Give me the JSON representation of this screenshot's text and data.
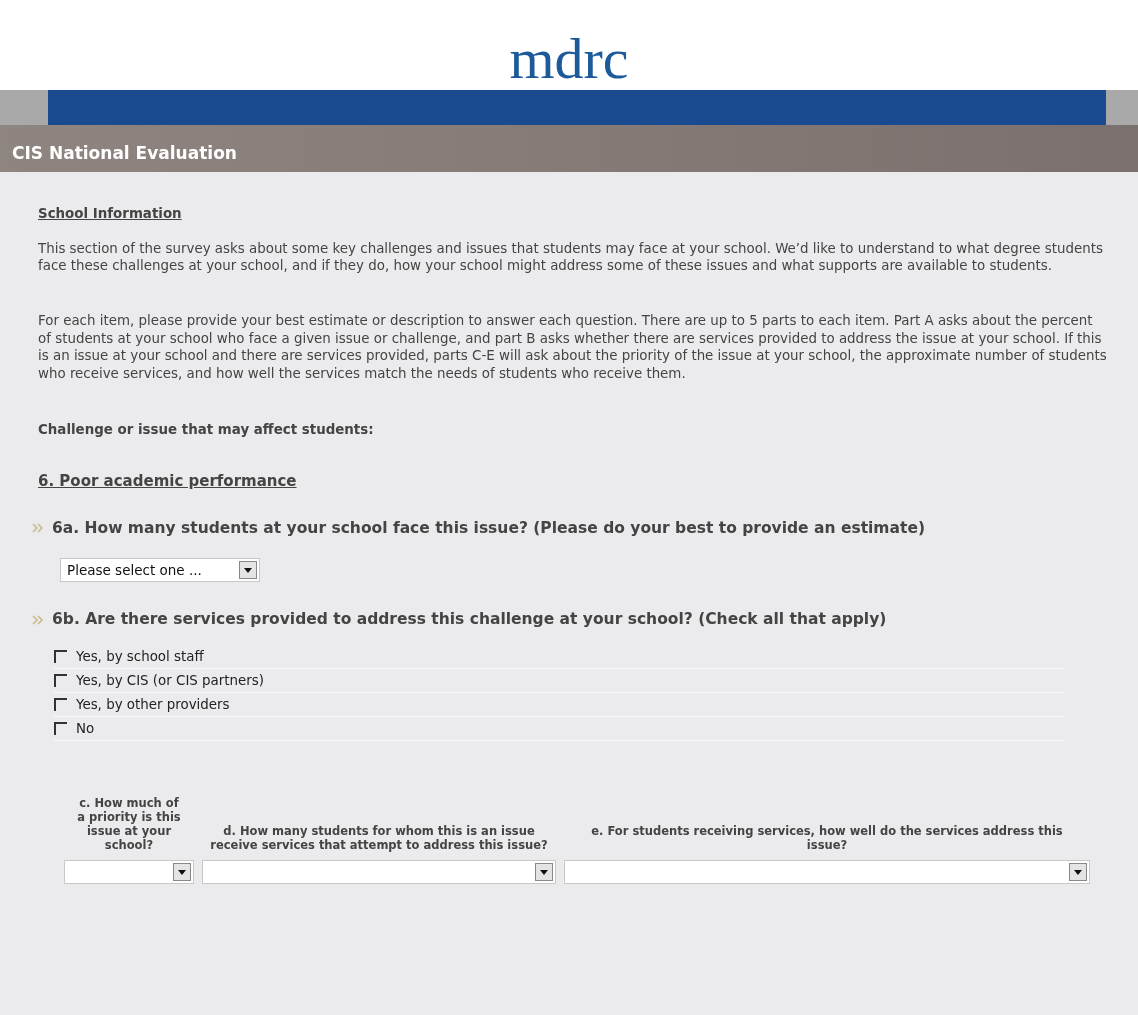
{
  "logo": "mdrc",
  "header": {
    "title": "CIS National Evaluation"
  },
  "section": {
    "title": "School Information",
    "paragraphs": [
      "This section of the survey asks about some key challenges and issues that students may face at your school. We’d like to understand to what degree students face these challenges at your school, and if they do, how your school might address some of these issues and what supports are available to students.",
      "For each item, please provide your best estimate or description to answer each question. There are up to 5 parts to each item. Part A asks about the percent of students at your school who face a given issue or challenge, and part B asks whether there are services provided to address the issue at your school. If this is an issue at your school and there are services provided, parts C-E will ask about the priority of the issue at your school, the approximate number of students who receive services, and how well the services match the needs of students who receive them."
    ]
  },
  "challenge_label": "Challenge or issue that may affect students:",
  "item_title": "6. Poor academic performance",
  "question_a": {
    "text": "6a. How many students at your school face this issue? (Please do your best to provide an estimate)",
    "value": "Please select one ..."
  },
  "question_b": {
    "text": "6b. Are there services provided to address this challenge at your school? (Check all that apply)",
    "options": [
      {
        "label": "Yes, by school staff",
        "checked": false
      },
      {
        "label": "Yes, by CIS (or CIS partners)",
        "checked": false
      },
      {
        "label": "Yes, by other providers",
        "checked": false
      },
      {
        "label": "No",
        "checked": false
      }
    ]
  },
  "followups": [
    {
      "label": "c. How much of a priority is this issue at your school?"
    },
    {
      "label": "d. How many students for whom this is an issue receive services that attempt to address this issue?"
    },
    {
      "label": "e. For students receiving services, how well do the services address this issue?"
    }
  ]
}
